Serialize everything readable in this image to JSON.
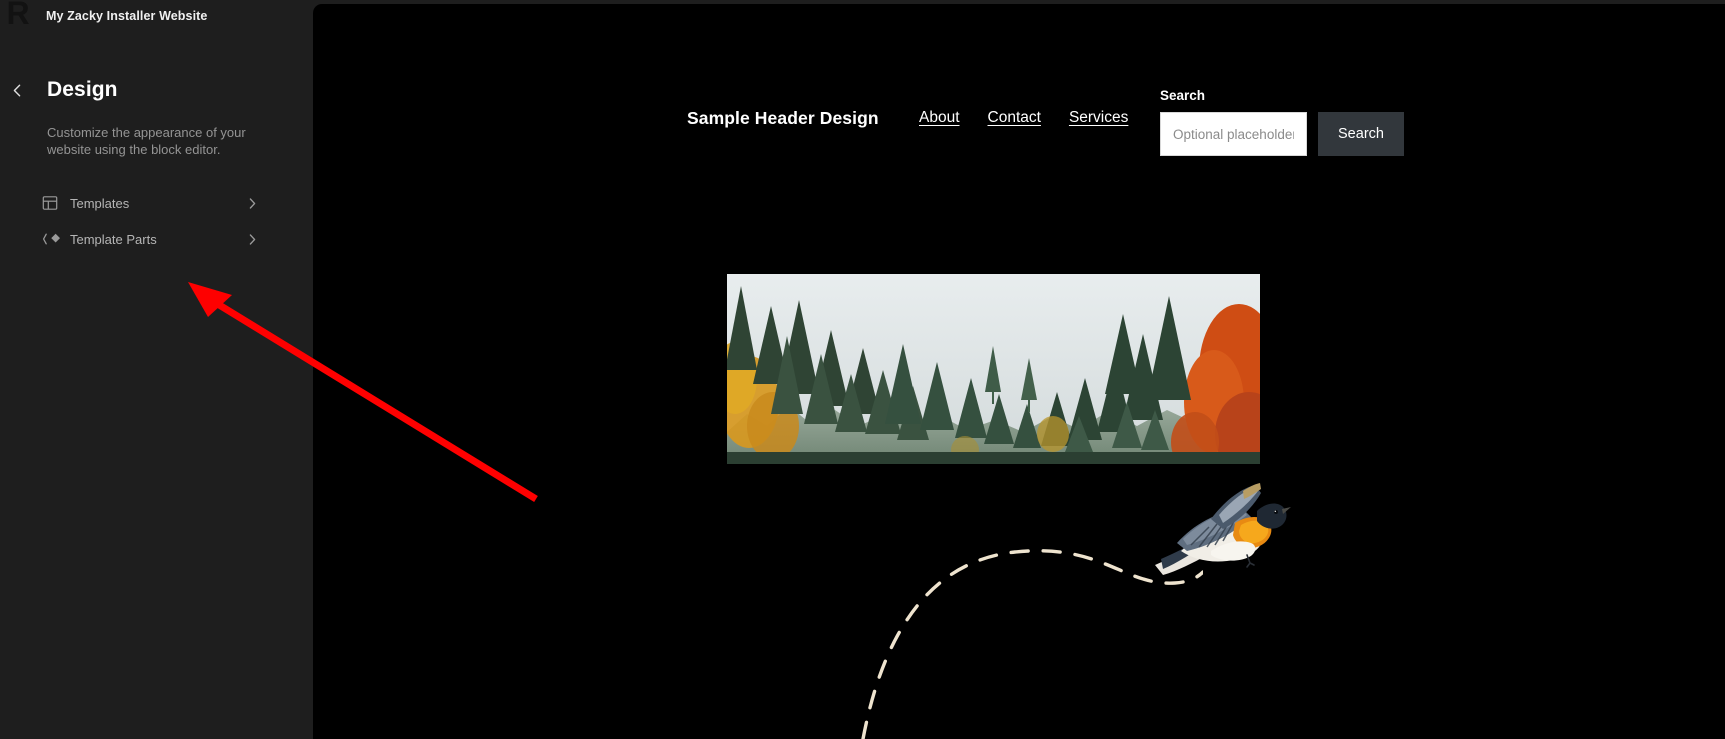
{
  "sidebar": {
    "logo_letter": "R",
    "site_title": "My Zacky Installer Website",
    "back_icon": "chevron-left-icon",
    "page_title": "Design",
    "description": "Customize the appearance of your website using the block editor.",
    "items": [
      {
        "label": "Templates",
        "icon": "layout-template-icon",
        "arrow": "chevron-right-icon"
      },
      {
        "label": "Template Parts",
        "icon": "template-parts-diamond-icon",
        "arrow": "chevron-right-icon"
      }
    ]
  },
  "preview": {
    "header": {
      "title": "Sample Header Design",
      "nav": [
        {
          "label": "About"
        },
        {
          "label": "Contact"
        },
        {
          "label": "Services"
        }
      ],
      "search": {
        "label": "Search",
        "placeholder": "Optional placeholder...",
        "value": "",
        "button_label": "Search"
      }
    },
    "media": {
      "forest_image_alt": "Autumn forest with evergreen and orange foliage trees under a pale sky",
      "bird_alt": "Flying bird with orange breast and dark wings",
      "flight_path_alt": "Dashed curved flight trail"
    }
  },
  "annotation": {
    "arrow_color": "#fe0000",
    "points_to": "Template Parts"
  },
  "colors": {
    "sidebar_bg": "#1e1e1e",
    "canvas_bg": "#000000",
    "accent_button": "#32373c",
    "annotation_red": "#fe0000",
    "path_cream": "#efe4cf"
  }
}
